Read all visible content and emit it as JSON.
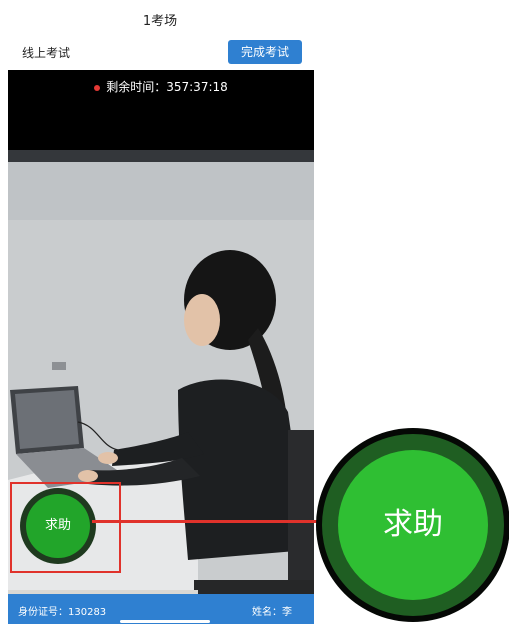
{
  "header": {
    "title": "1考场",
    "subtitle": "线上考试",
    "finish_button": "完成考试"
  },
  "timer": {
    "label": "剩余时间：",
    "value": "357:37:18",
    "dot_color": "#e53935"
  },
  "help": {
    "small_label": "求助",
    "zoom_label": "求助",
    "button_color": "#22a52a",
    "annotation_color": "#e0322b"
  },
  "footer": {
    "id_label": "身份证号：",
    "id_value": "130283",
    "name_label": "姓名：",
    "name_value": "李"
  },
  "colors": {
    "accent": "#2f80d1"
  }
}
